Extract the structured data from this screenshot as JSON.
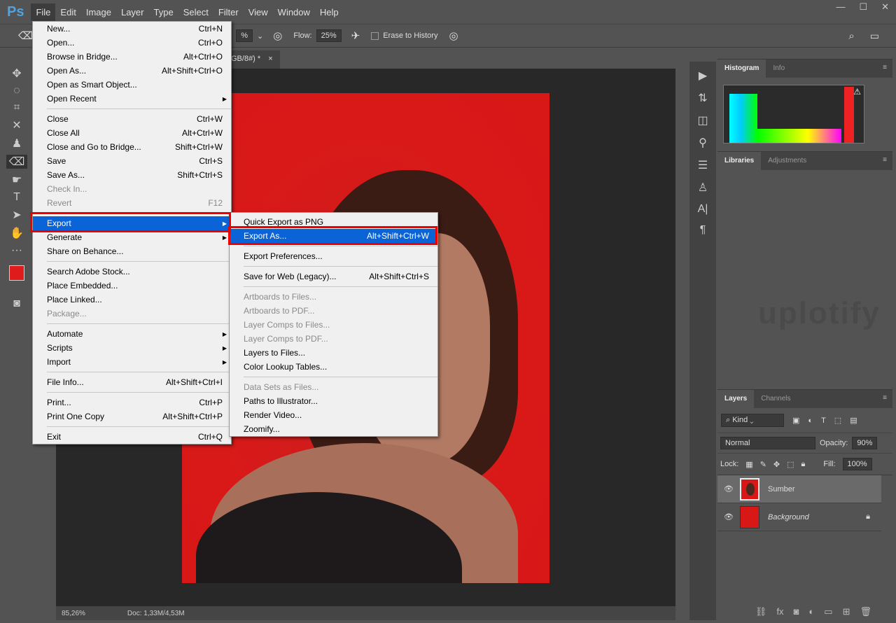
{
  "app": {
    "logo": "Ps",
    "menus": [
      "File",
      "Edit",
      "Image",
      "Layer",
      "Type",
      "Select",
      "Filter",
      "View",
      "Window",
      "Help"
    ],
    "window_controls": [
      "—",
      "☐",
      "✕"
    ]
  },
  "options": {
    "opacity_partial": "%",
    "flow_label": "Flow:",
    "flow_value": "25%",
    "erase_history": "Erase to History"
  },
  "document": {
    "tab_title": "GB/8#) *",
    "tab_close": "×",
    "zoom": "85,26%",
    "doc_size": "Doc: 1,33M/4,53M"
  },
  "file_menu": [
    {
      "label": "New...",
      "shortcut": "Ctrl+N"
    },
    {
      "label": "Open...",
      "shortcut": "Ctrl+O"
    },
    {
      "label": "Browse in Bridge...",
      "shortcut": "Alt+Ctrl+O"
    },
    {
      "label": "Open As...",
      "shortcut": "Alt+Shift+Ctrl+O"
    },
    {
      "label": "Open as Smart Object...",
      "shortcut": ""
    },
    {
      "label": "Open Recent",
      "shortcut": "",
      "submenu": true
    },
    {
      "sep": true
    },
    {
      "label": "Close",
      "shortcut": "Ctrl+W"
    },
    {
      "label": "Close All",
      "shortcut": "Alt+Ctrl+W"
    },
    {
      "label": "Close and Go to Bridge...",
      "shortcut": "Shift+Ctrl+W"
    },
    {
      "label": "Save",
      "shortcut": "Ctrl+S"
    },
    {
      "label": "Save As...",
      "shortcut": "Shift+Ctrl+S"
    },
    {
      "label": "Check In...",
      "shortcut": "",
      "disabled": true
    },
    {
      "label": "Revert",
      "shortcut": "F12",
      "disabled": true
    },
    {
      "sep": true
    },
    {
      "label": "Export",
      "shortcut": "",
      "submenu": true,
      "highlighted": true
    },
    {
      "label": "Generate",
      "shortcut": "",
      "submenu": true
    },
    {
      "label": "Share on Behance...",
      "shortcut": ""
    },
    {
      "sep": true
    },
    {
      "label": "Search Adobe Stock...",
      "shortcut": ""
    },
    {
      "label": "Place Embedded...",
      "shortcut": ""
    },
    {
      "label": "Place Linked...",
      "shortcut": ""
    },
    {
      "label": "Package...",
      "shortcut": "",
      "disabled": true
    },
    {
      "sep": true
    },
    {
      "label": "Automate",
      "shortcut": "",
      "submenu": true
    },
    {
      "label": "Scripts",
      "shortcut": "",
      "submenu": true
    },
    {
      "label": "Import",
      "shortcut": "",
      "submenu": true
    },
    {
      "sep": true
    },
    {
      "label": "File Info...",
      "shortcut": "Alt+Shift+Ctrl+I"
    },
    {
      "sep": true
    },
    {
      "label": "Print...",
      "shortcut": "Ctrl+P"
    },
    {
      "label": "Print One Copy",
      "shortcut": "Alt+Shift+Ctrl+P"
    },
    {
      "sep": true
    },
    {
      "label": "Exit",
      "shortcut": "Ctrl+Q"
    }
  ],
  "export_submenu": [
    {
      "label": "Quick Export as PNG",
      "shortcut": ""
    },
    {
      "label": "Export As...",
      "shortcut": "Alt+Shift+Ctrl+W",
      "highlighted": true
    },
    {
      "sep": true
    },
    {
      "label": "Export Preferences...",
      "shortcut": ""
    },
    {
      "sep": true
    },
    {
      "label": "Save for Web (Legacy)...",
      "shortcut": "Alt+Shift+Ctrl+S"
    },
    {
      "sep": true
    },
    {
      "label": "Artboards to Files...",
      "shortcut": "",
      "disabled": true
    },
    {
      "label": "Artboards to PDF...",
      "shortcut": "",
      "disabled": true
    },
    {
      "label": "Layer Comps to Files...",
      "shortcut": "",
      "disabled": true
    },
    {
      "label": "Layer Comps to PDF...",
      "shortcut": "",
      "disabled": true
    },
    {
      "label": "Layers to Files...",
      "shortcut": ""
    },
    {
      "label": "Color Lookup Tables...",
      "shortcut": ""
    },
    {
      "sep": true
    },
    {
      "label": "Data Sets as Files...",
      "shortcut": "",
      "disabled": true
    },
    {
      "label": "Paths to Illustrator...",
      "shortcut": ""
    },
    {
      "label": "Render Video...",
      "shortcut": ""
    },
    {
      "label": "Zoomify...",
      "shortcut": ""
    }
  ],
  "panels": {
    "histogram_tabs": [
      "Histogram",
      "Info"
    ],
    "libraries_tabs": [
      "Libraries",
      "Adjustments"
    ],
    "watermark": "uplotify",
    "layers_tabs": [
      "Layers",
      "Channels"
    ],
    "filter_kind": "Kind",
    "blend_mode": "Normal",
    "opacity_label": "Opacity:",
    "opacity_value": "90%",
    "lock_label": "Lock:",
    "fill_label": "Fill:",
    "fill_value": "100%",
    "layers": [
      {
        "name": "Sumber",
        "selected": true
      },
      {
        "name": "Background",
        "locked": true
      }
    ]
  },
  "colors": {
    "accent": "#0a64d8",
    "highlight_box": "#e00000",
    "canvas_bg": "#d81717"
  }
}
